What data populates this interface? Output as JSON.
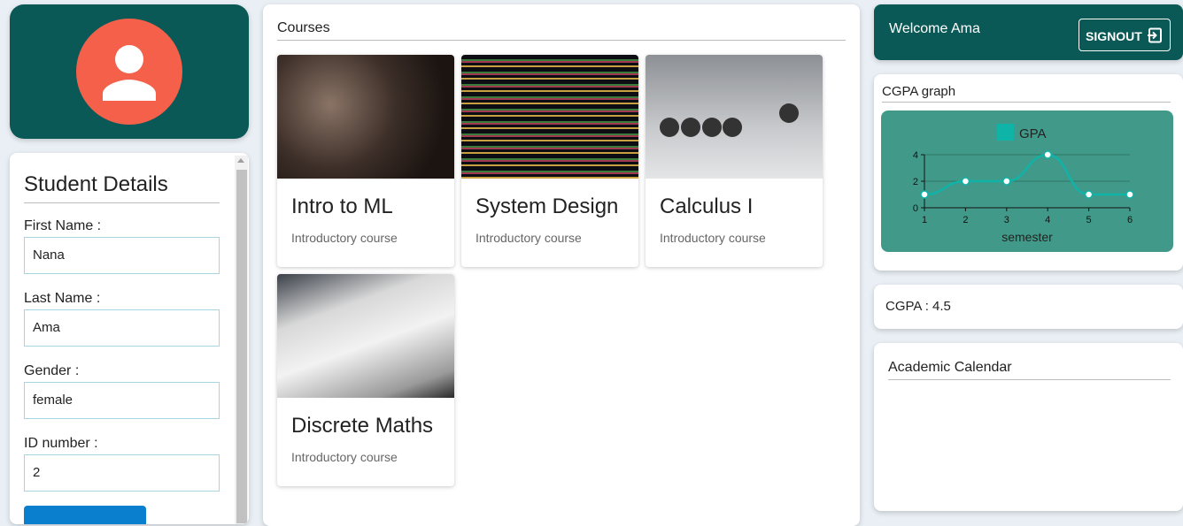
{
  "student": {
    "title": "Student Details",
    "fields": [
      {
        "label": "First Name :",
        "value": "Nana"
      },
      {
        "label": "Last Name :",
        "value": "Ama"
      },
      {
        "label": "Gender :",
        "value": "female"
      },
      {
        "label": "ID number :",
        "value": "2"
      }
    ]
  },
  "courses": {
    "title": "Courses",
    "items": [
      {
        "title": "Intro to ML",
        "subtitle": "Introductory course"
      },
      {
        "title": "System Design",
        "subtitle": "Introductory course"
      },
      {
        "title": "Calculus I",
        "subtitle": "Introductory course"
      },
      {
        "title": "Discrete Maths",
        "subtitle": "Introductory course"
      }
    ]
  },
  "header": {
    "welcome": "Welcome Ama",
    "signout": "SIGNOUT"
  },
  "graph": {
    "title": "CGPA graph"
  },
  "cgpa": {
    "label": "CGPA :",
    "value": "4.5"
  },
  "calendar": {
    "title": "Academic Calendar"
  },
  "colors": {
    "primary": "#0a5957",
    "avatar": "#f4604a",
    "line": "#0fb3a8"
  },
  "chart_data": {
    "type": "line",
    "legend": "GPA",
    "x": [
      1,
      2,
      3,
      4,
      5,
      6
    ],
    "values": [
      1,
      2,
      2,
      4,
      1,
      1
    ],
    "xlabel": "semester",
    "ylabel": "",
    "ylim": [
      0,
      4
    ],
    "yticks": [
      0,
      2,
      4
    ],
    "grid": true,
    "legend_position": "top"
  }
}
